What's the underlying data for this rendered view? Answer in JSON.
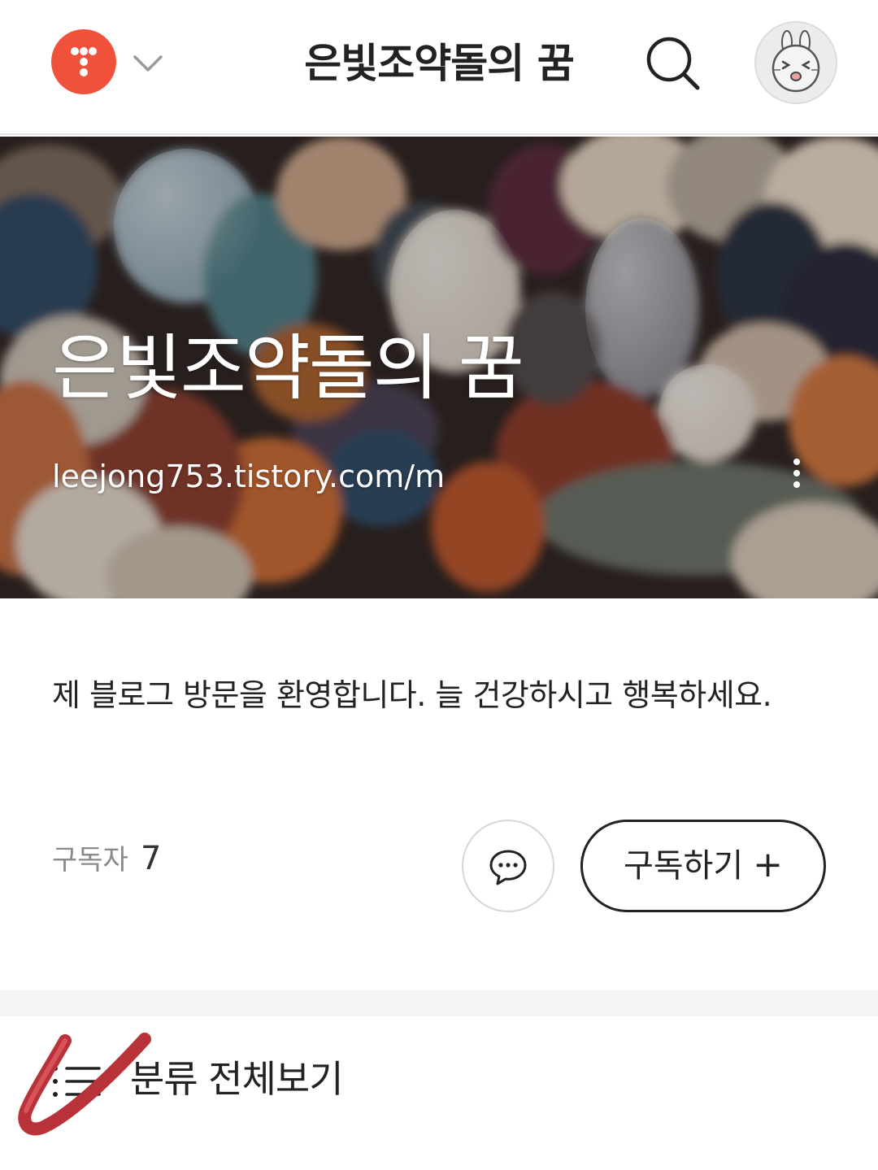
{
  "header": {
    "title": "은빛조약돌의 꿈",
    "logo_icon": "tistory-logo-icon",
    "dropdown_icon": "chevron-down-icon",
    "search_icon": "search-icon",
    "avatar_icon": "rabbit-avatar-icon",
    "brand_color": "#f0513b"
  },
  "hero": {
    "title": "은빛조약돌의 꿈",
    "url": "leejong753.tistory.com/m",
    "more_icon": "more-vertical-icon"
  },
  "intro": {
    "description": "제 블로그 방문을 환영합니다. 늘 건강하시고 행복하세요."
  },
  "stats": {
    "subscriber_label": "구독자",
    "subscriber_count": "7"
  },
  "actions": {
    "message_icon": "chat-bubble-icon",
    "subscribe_label": "구독하기",
    "subscribe_plus": "+"
  },
  "category": {
    "label": "분류 전체보기",
    "icon": "list-icon",
    "overlay_icon": "red-checkmark-icon"
  }
}
